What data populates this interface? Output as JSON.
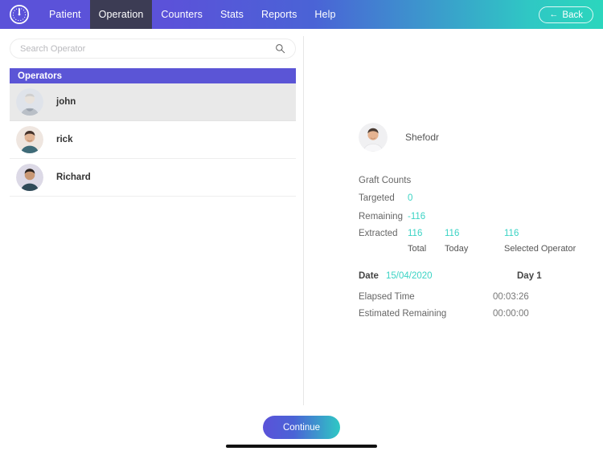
{
  "app": {
    "logo_icon": "gauge-logo-icon",
    "accent_purple": "#5b52d9",
    "accent_teal": "#2bd6bd",
    "value_teal": "#3ad3c4",
    "active_tab_bg": "#3c3c54"
  },
  "nav": {
    "items": [
      {
        "label": "Patient",
        "active": false
      },
      {
        "label": "Operation",
        "active": true
      },
      {
        "label": "Counters",
        "active": false
      },
      {
        "label": "Stats",
        "active": false
      },
      {
        "label": "Reports",
        "active": false
      },
      {
        "label": "Help",
        "active": false
      }
    ],
    "back": {
      "label": "Back",
      "arrow": "←",
      "icon": "arrow-left-icon"
    }
  },
  "search": {
    "placeholder": "Search Operator",
    "value": "",
    "icon": "search-icon"
  },
  "operators": {
    "header": "Operators",
    "items": [
      {
        "name": "john",
        "selected": true
      },
      {
        "name": "rick",
        "selected": false
      },
      {
        "name": "Richard",
        "selected": false
      }
    ]
  },
  "detail": {
    "profile_name": "Shefodr",
    "graft_counts_title": "Graft Counts",
    "rows": [
      {
        "label": "Targeted",
        "total": "0",
        "today": "",
        "selected_operator": ""
      },
      {
        "label": "Remaining",
        "total": "-116",
        "today": "",
        "selected_operator": ""
      },
      {
        "label": "Extracted",
        "total": "116",
        "today": "116",
        "selected_operator": "116"
      }
    ],
    "column_headers": {
      "total": "Total",
      "today": "Today",
      "selected_operator": "Selected Operator"
    },
    "date": {
      "label": "Date",
      "value": "15/04/2020",
      "day": "Day 1"
    },
    "elapsed": {
      "label": "Elapsed Time",
      "value": "00:03:26"
    },
    "estimated_remaining": {
      "label": "Estimated Remaining",
      "value": "00:00:00"
    }
  },
  "footer": {
    "continue_label": "Continue"
  }
}
